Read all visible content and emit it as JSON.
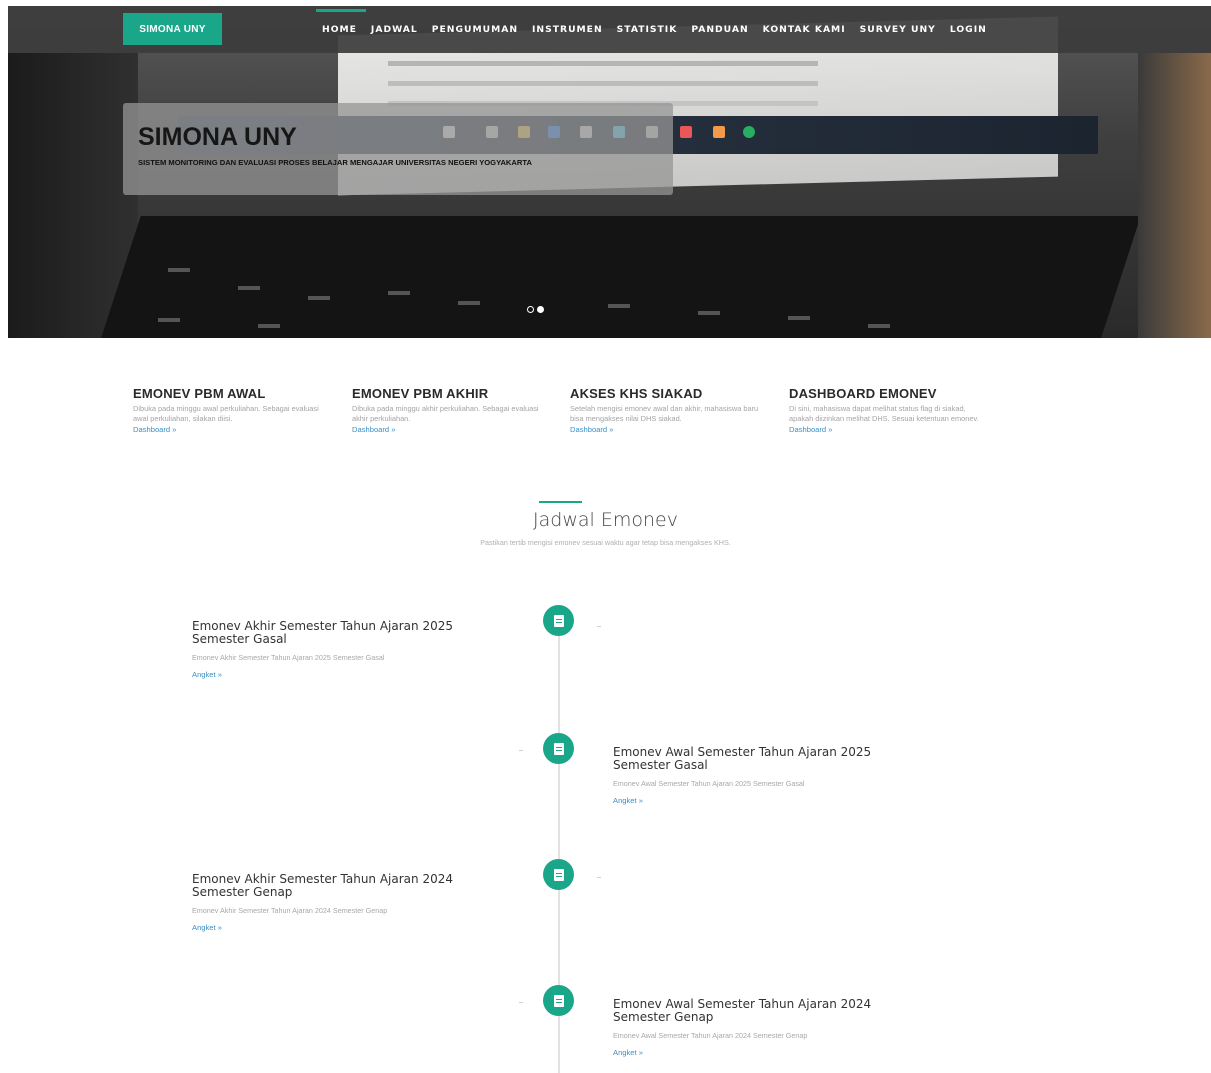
{
  "navbar": {
    "brand": "SIMONA UNY",
    "items": [
      "HOME",
      "JADWAL",
      "PENGUMUMAN",
      "INSTRUMEN",
      "STATISTIK",
      "PANDUAN",
      "KONTAK KAMI",
      "SURVEY UNY",
      "LOGIN"
    ],
    "active": "HOME"
  },
  "hero": {
    "title": "SIMONA UNY",
    "subtitle": "SISTEM MONITORING DAN EVALUASI PROSES BELAJAR MENGAJAR UNIVERSITAS NEGERI YOGYAKARTA",
    "slides": 2,
    "active_slide": 2
  },
  "features": [
    {
      "title": "EMONEV PBM AWAL",
      "desc": "Dibuka pada minggu awal perkuliahan. Sebagai evaluasi awal perkuliahan, silakan diisi.",
      "link": "Dashboard »"
    },
    {
      "title": "EMONEV PBM AKHIR",
      "desc": "Dibuka pada minggu akhir perkuliahan. Sebagai evaluasi akhir perkuliahan.",
      "link": "Dashboard »"
    },
    {
      "title": "AKSES KHS SIAKAD",
      "desc": "Setelah mengisi emonev awal dan akhir, mahasiswa baru bisa mengakses nilai DHS siakad.",
      "link": "Dashboard »"
    },
    {
      "title": "DASHBOARD EMONEV",
      "desc": "Di sini, mahasiswa dapat melihat status flag di siakad, apakah diizinkan melihat DHS. Sesuai ketentuan emonev.",
      "link": "Dashboard »"
    }
  ],
  "schedule": {
    "title": "Jadwal Emonev",
    "subtitle": "Pastikan tertib mengisi emonev sesuai waktu agar tetap bisa mengakses KHS.",
    "items": [
      {
        "title": "Emonev Akhir Semester Tahun Ajaran 2025 Semester Gasal",
        "desc": "Emonev Akhir Semester Tahun Ajaran 2025 Semester Gasal",
        "link": "Angket »"
      },
      {
        "title": "Emonev Awal Semester Tahun Ajaran 2025 Semester Gasal",
        "desc": "Emonev Awal Semester Tahun Ajaran 2025 Semester Gasal",
        "link": "Angket »"
      },
      {
        "title": "Emonev Akhir Semester Tahun Ajaran 2024 Semester Genap",
        "desc": "Emonev Akhir Semester Tahun Ajaran 2024 Semester Genap",
        "link": "Angket »"
      },
      {
        "title": "Emonev Awal Semester Tahun Ajaran 2024 Semester Genap",
        "desc": "Emonev Awal Semester Tahun Ajaran 2024 Semester Genap",
        "link": "Angket »"
      }
    ]
  },
  "colors": {
    "accent": "#1aa689",
    "link": "#3a8fc8",
    "navbar": "#3c3c3c"
  },
  "icons": {
    "timeline_node": "file-icon"
  }
}
